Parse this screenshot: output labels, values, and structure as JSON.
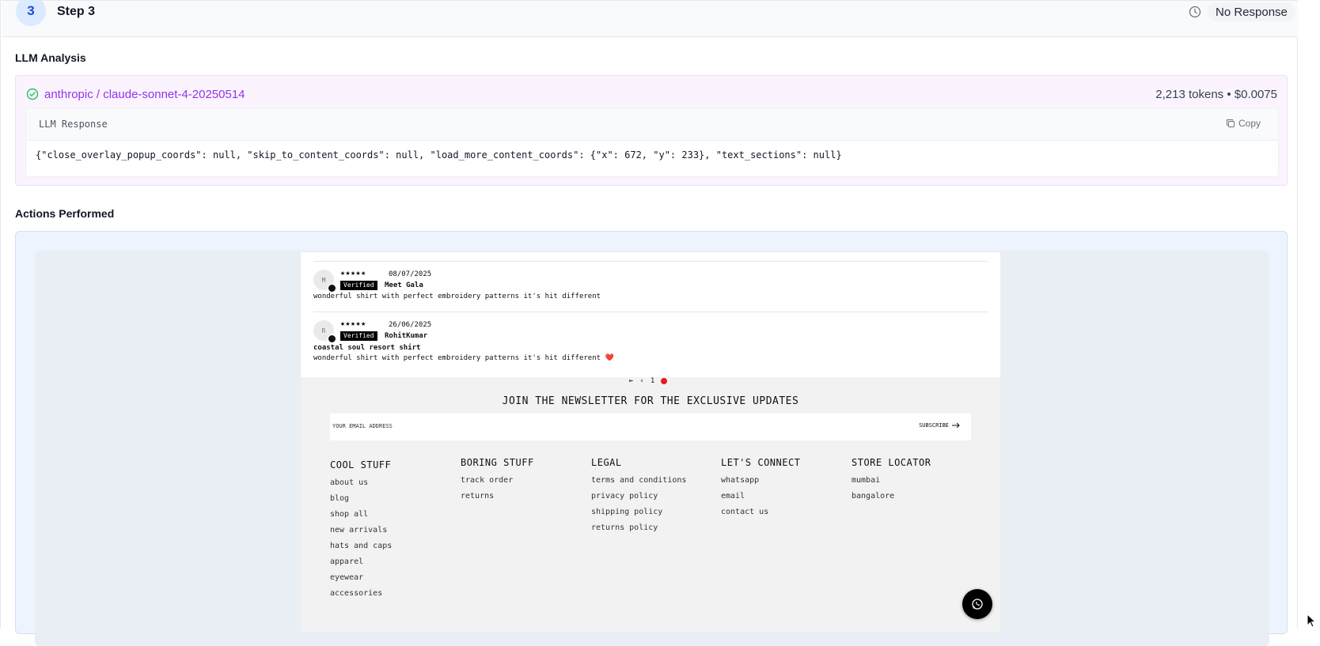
{
  "step": {
    "number": "3",
    "title": "Step 3",
    "status": "No Response"
  },
  "llm_analysis": {
    "section_title": "LLM Analysis",
    "model": "anthropic / claude-sonnet-4-20250514",
    "token_info": "2,213 tokens • $0.0075",
    "response_label": "LLM Response",
    "copy_label": "Copy",
    "response_text": "{\"close_overlay_popup_coords\": null, \"skip_to_content_coords\": null, \"load_more_content_coords\": {\"x\": 672, \"y\": 233}, \"text_sections\": null}"
  },
  "actions": {
    "section_title": "Actions Performed"
  },
  "screenshot": {
    "reviews": [
      {
        "initial": "M",
        "stars": "★★★★★",
        "date": "08/07/2025",
        "verified": "Verified",
        "name": "Meet Gala",
        "title": "",
        "text": "wonderful shirt with perfect embroidery patterns it's hit different"
      },
      {
        "initial": "R",
        "stars": "★★★★★",
        "date": "26/06/2025",
        "verified": "Verified",
        "name": "RohitKumar",
        "title": "coastal soul resort shirt",
        "text": "wonderful shirt with perfect embroidery patterns it's hit different ❤️"
      }
    ],
    "pager": {
      "first": "⇤",
      "prev": "‹",
      "page": "1"
    },
    "newsletter": {
      "title": "JOIN THE NEWSLETTER FOR THE EXCLUSIVE UPDATES",
      "placeholder": "YOUR EMAIL ADDRESS",
      "subscribe": "SUBSCRIBE"
    },
    "footer_columns": [
      {
        "heading": "COOL STUFF",
        "links": [
          "about us",
          "blog",
          "shop all",
          "new arrivals",
          "hats and caps",
          "apparel",
          "eyewear",
          "accessories"
        ]
      },
      {
        "heading": "BORING STUFF",
        "links": [
          "track order",
          "returns"
        ]
      },
      {
        "heading": "LEGAL",
        "links": [
          "terms and conditions",
          "privacy policy",
          "shipping policy",
          "returns policy"
        ]
      },
      {
        "heading": "LET'S CONNECT",
        "links": [
          "whatsapp",
          "email",
          "contact us"
        ]
      },
      {
        "heading": "STORE LOCATOR",
        "links": [
          "mumbai",
          "bangalore"
        ]
      }
    ]
  },
  "colors": {
    "accent_purple": "#9333ea",
    "step_badge_bg": "#dbeafe",
    "success_green": "#22c55e"
  }
}
